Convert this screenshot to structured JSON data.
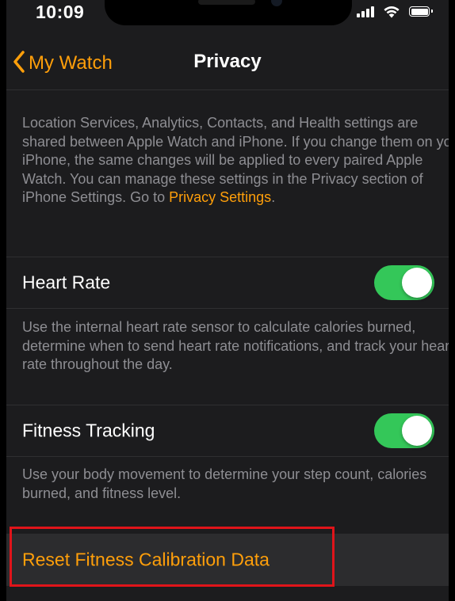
{
  "status_bar": {
    "time": "10:09",
    "icons": [
      "signal-icon",
      "wifi-icon",
      "battery-icon"
    ]
  },
  "nav": {
    "back_label": "My Watch",
    "title": "Privacy"
  },
  "intro": {
    "text": "Location Services, Analytics, Contacts, and Health settings are shared between Apple Watch and iPhone. If you change them on your iPhone, the same changes will be applied to every paired Apple Watch. You can manage these settings in the Privacy section of iPhone Settings. Go to ",
    "link": "Privacy Settings",
    "suffix": "."
  },
  "heart_rate": {
    "label": "Heart Rate",
    "enabled": true,
    "description": "Use the internal heart rate sensor to calculate calories burned, determine when to send heart rate notifications, and track your heart rate throughout the day."
  },
  "fitness_tracking": {
    "label": "Fitness Tracking",
    "enabled": true,
    "description": "Use your body movement to determine your step count, calories burned, and fitness level."
  },
  "reset": {
    "label": "Reset Fitness Calibration Data"
  },
  "colors": {
    "accent": "#ff9f0a",
    "toggle_on": "#34c759",
    "background": "#1c1c1e",
    "highlight": "#e0141a"
  }
}
